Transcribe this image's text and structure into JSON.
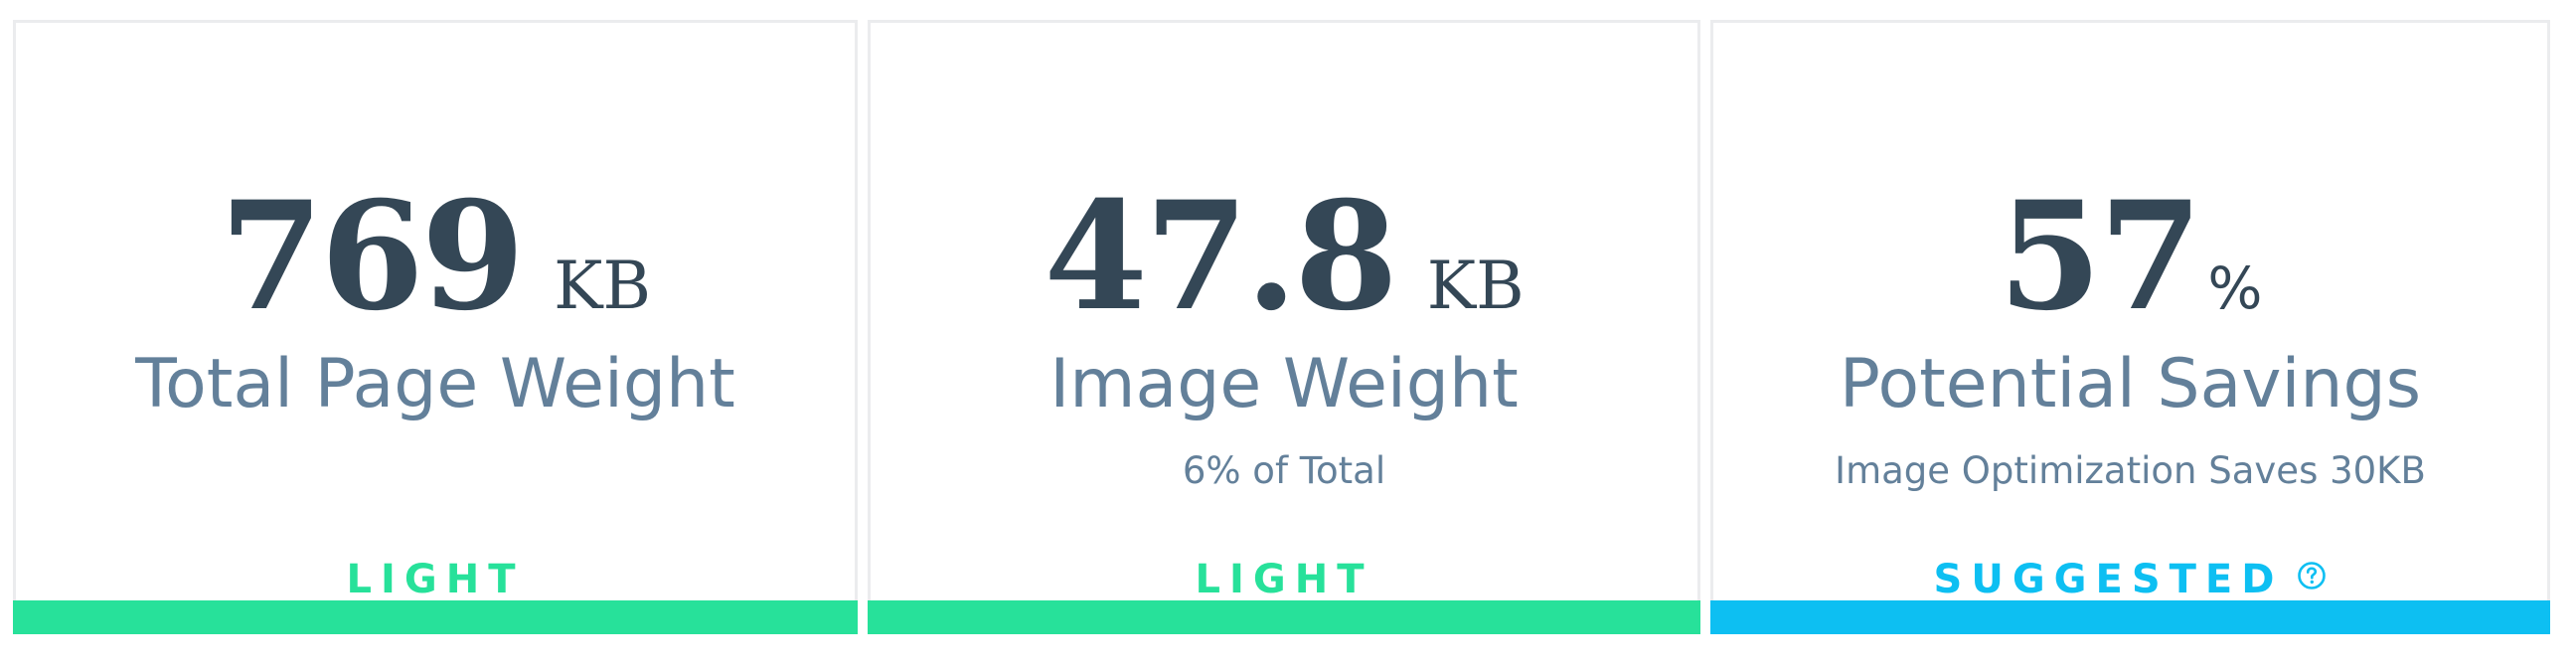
{
  "cards": [
    {
      "value": "769",
      "unit": "KB",
      "label": "Total Page Weight",
      "sublabel": "",
      "status": "LIGHT",
      "status_color": "#27e19a"
    },
    {
      "value": "47.8",
      "unit": "KB",
      "label": "Image Weight",
      "sublabel": "6% of Total",
      "status": "LIGHT",
      "status_color": "#27e19a"
    },
    {
      "value": "57",
      "unit": "%",
      "label": "Potential Savings",
      "sublabel": "Image Optimization Saves 30KB",
      "status": "SUGGESTED",
      "status_color": "#0dbff2",
      "status_icon": "help-circle-icon"
    }
  ],
  "colors": {
    "value_text": "#344756",
    "label_text": "#63809a",
    "card_border": "#ebecee"
  }
}
